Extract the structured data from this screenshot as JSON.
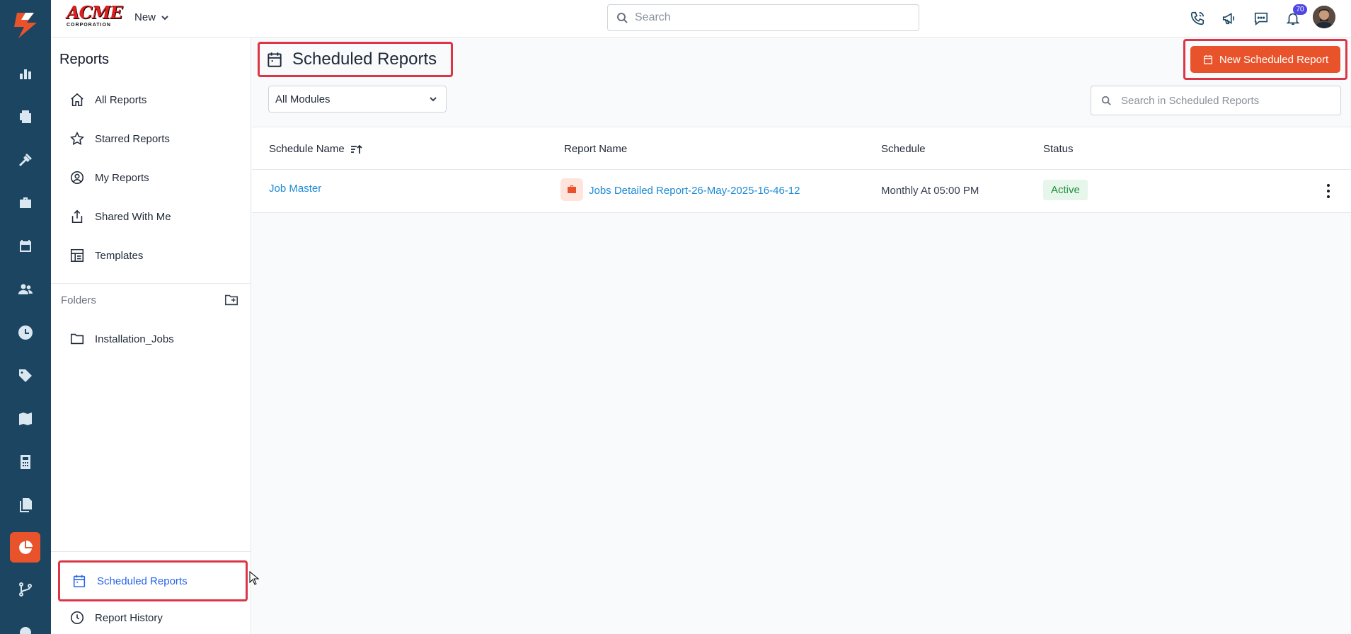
{
  "topbar": {
    "brand": "ACME",
    "brand_sub": "CORPORATION",
    "new_label": "New",
    "search_placeholder": "Search",
    "notification_count": "70"
  },
  "rail": {
    "items": [
      "logo-icon",
      "dashboard-icon",
      "estimates-icon",
      "tools-icon",
      "briefcase-icon",
      "calendar-icon",
      "users-icon",
      "clock-icon",
      "tag-icon",
      "map-icon",
      "calculator-icon",
      "documents-icon",
      "reports-pie-icon",
      "flow-icon",
      "settings-icon"
    ]
  },
  "sidebar": {
    "title": "Reports",
    "items": [
      {
        "label": "All Reports",
        "icon": "home-icon"
      },
      {
        "label": "Starred Reports",
        "icon": "star-icon"
      },
      {
        "label": "My Reports",
        "icon": "user-circle-icon"
      },
      {
        "label": "Shared With Me",
        "icon": "share-icon"
      },
      {
        "label": "Templates",
        "icon": "template-icon"
      }
    ],
    "folders_label": "Folders",
    "folders": [
      {
        "label": "Installation_Jobs",
        "icon": "folder-icon"
      }
    ],
    "bottom_items": [
      {
        "label": "Scheduled Reports",
        "icon": "calendar-icon",
        "active": true
      },
      {
        "label": "Report History",
        "icon": "clock-icon"
      }
    ]
  },
  "main": {
    "title": "Scheduled Reports",
    "new_button": "New Scheduled Report",
    "module_filter": "All Modules",
    "search_placeholder": "Search in Scheduled Reports",
    "columns": [
      "Schedule Name",
      "Report Name",
      "Schedule",
      "Status"
    ],
    "rows": [
      {
        "schedule_name": "Job Master",
        "report_name": "Jobs Detailed Report-26-May-2025-16-46-12",
        "schedule": "Monthly At 05:00 PM",
        "status": "Active"
      }
    ]
  },
  "colors": {
    "rail_bg": "#1b4560",
    "accent": "#e8532b",
    "link": "#1d8ad6",
    "highlight_border": "#dc3545",
    "status_active": "#1e8e3e"
  }
}
